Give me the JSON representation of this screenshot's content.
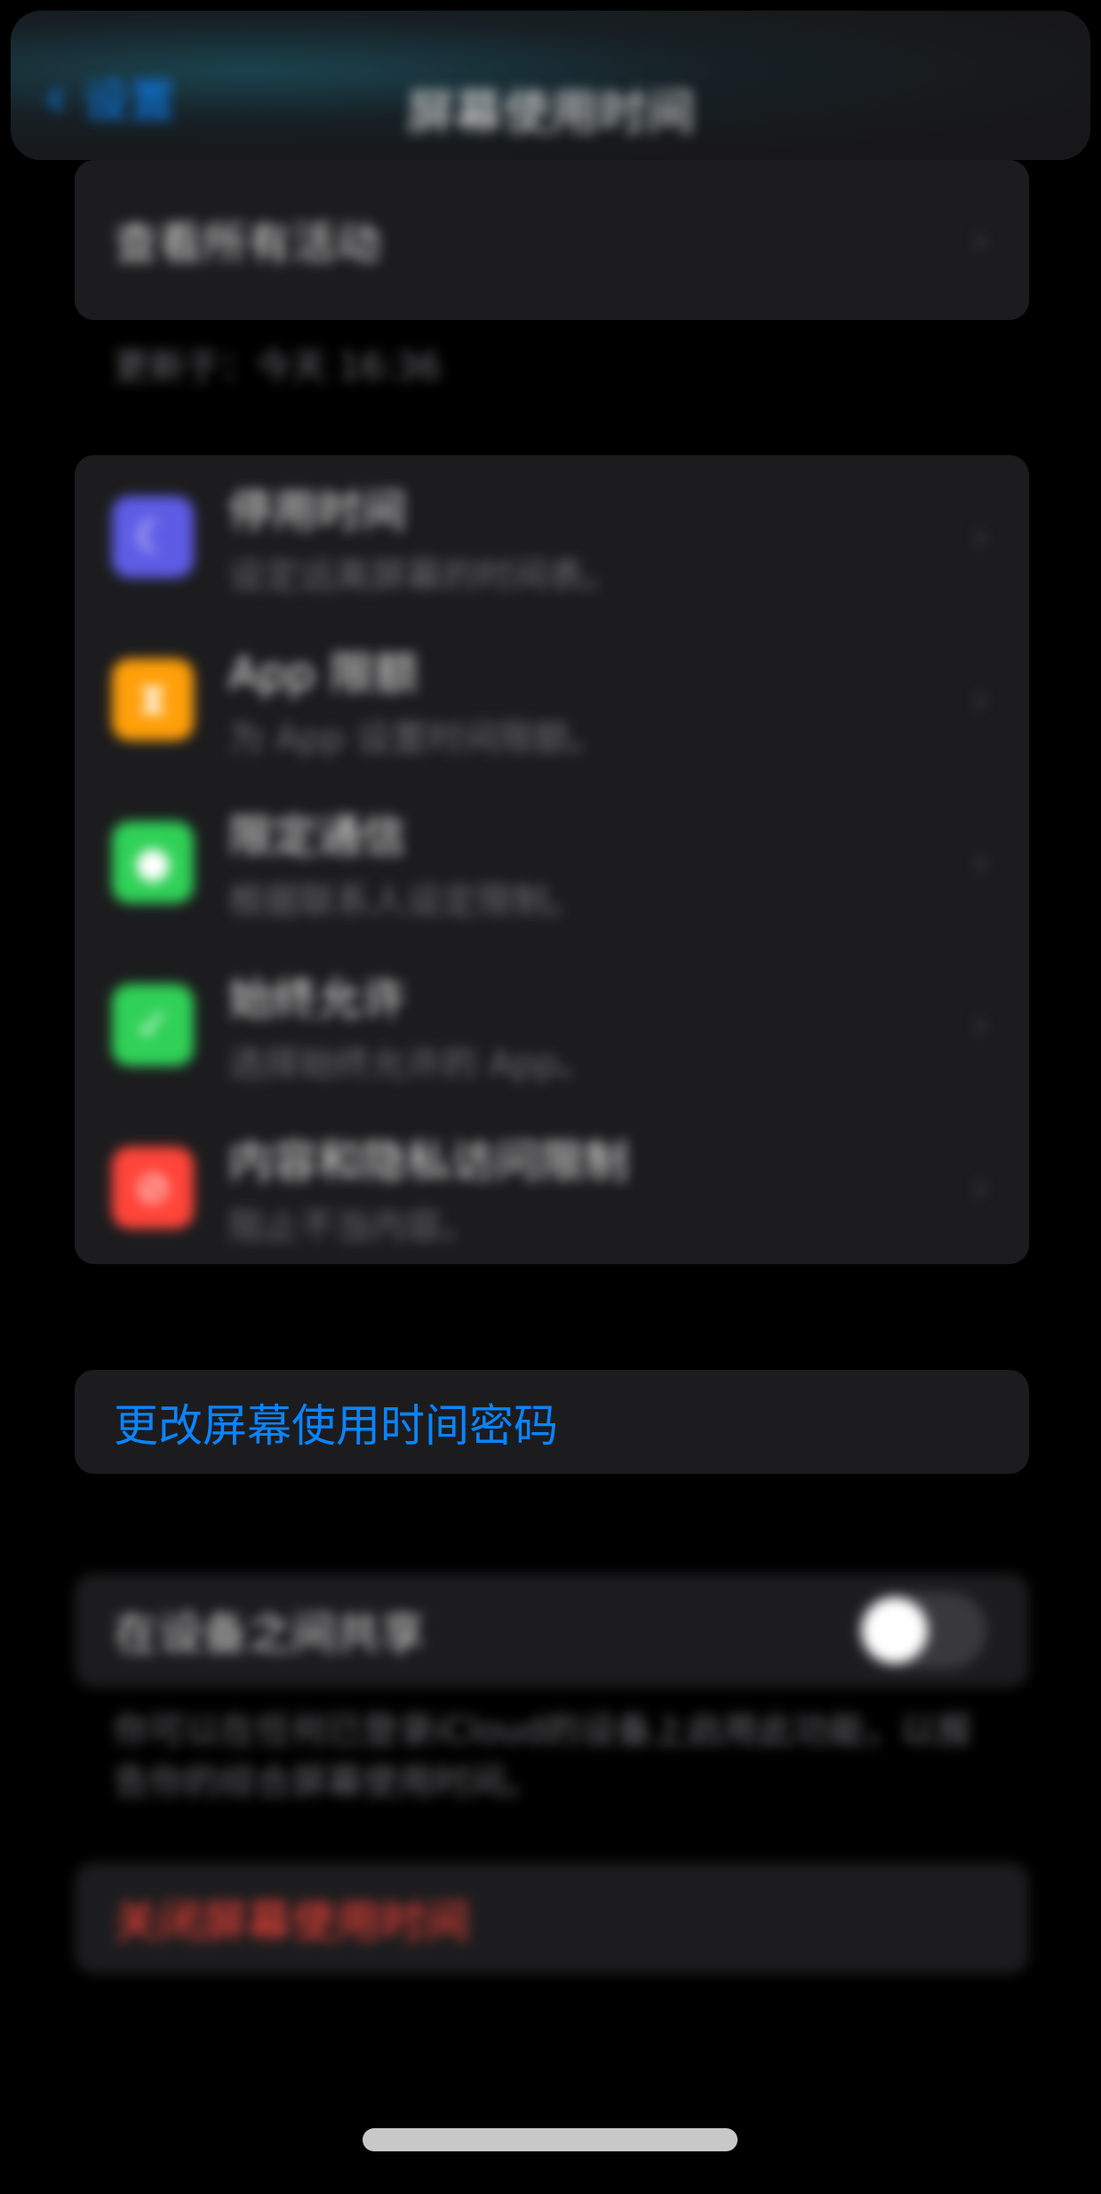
{
  "nav": {
    "back_label": "设置",
    "title": "屏幕使用时间"
  },
  "activity": {
    "label": "查看所有活动",
    "updated": "更新于：今天 16:36"
  },
  "limits": [
    {
      "title": "停用时间",
      "subtitle": "设定远离屏幕的时间表。",
      "icon": "downtime-icon",
      "color": "#5e5ce6"
    },
    {
      "title": "App 限额",
      "subtitle": "为 App 设置时间限额。",
      "icon": "hourglass-icon",
      "color": "#ff9f0a"
    },
    {
      "title": "限定通信",
      "subtitle": "根据联系人设定限制。",
      "icon": "person-icon",
      "color": "#30d158"
    },
    {
      "title": "始终允许",
      "subtitle": "选择始终允许的 App。",
      "icon": "checkmark-icon",
      "color": "#30d158"
    },
    {
      "title": "内容和隐私访问限制",
      "subtitle": "阻止不当内容。",
      "icon": "no-entry-icon",
      "color": "#ff453a"
    }
  ],
  "passcode": {
    "label": "更改屏幕使用时间密码",
    "color": "#0a84ff"
  },
  "share": {
    "label": "在设备之间共享",
    "toggle_on": false,
    "footnote": "你可以在任何已登录iCloud的设备上启用此功能，以报告你的综合屏幕使用时间。"
  },
  "turn_off": {
    "label": "关闭屏幕使用时间",
    "color": "#ff453a"
  }
}
